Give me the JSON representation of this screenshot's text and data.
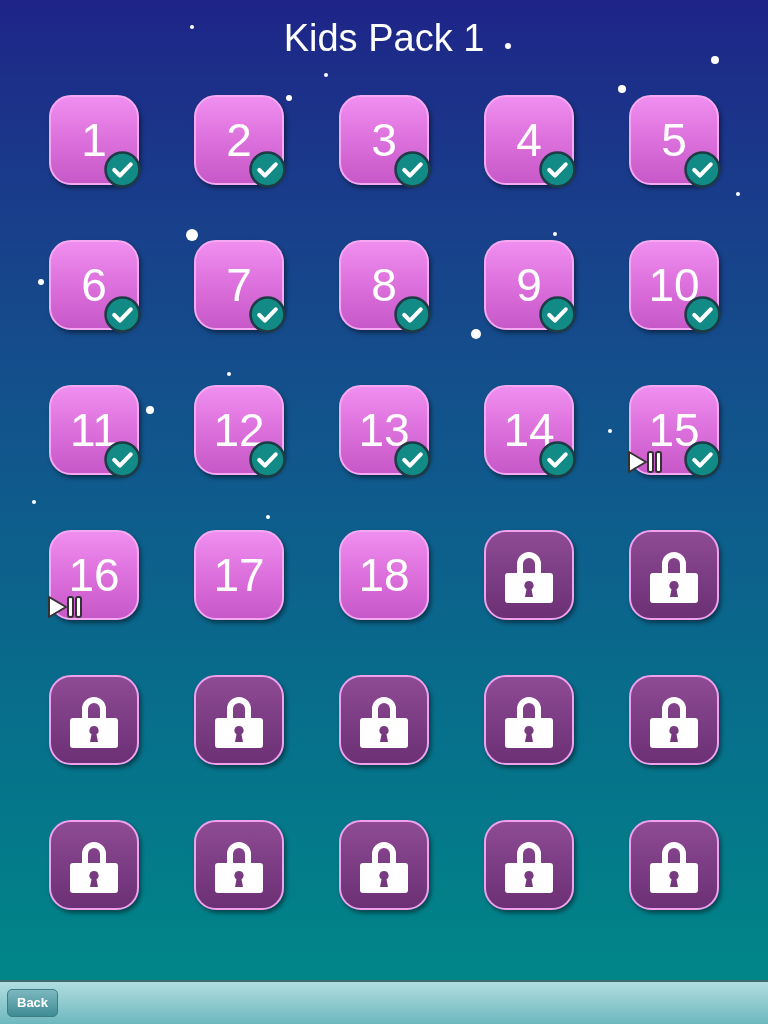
{
  "title": "Kids Pack 1",
  "levels": [
    {
      "kind": "unlocked",
      "number": "1",
      "completed": true,
      "resumable": false
    },
    {
      "kind": "unlocked",
      "number": "2",
      "completed": true,
      "resumable": false
    },
    {
      "kind": "unlocked",
      "number": "3",
      "completed": true,
      "resumable": false
    },
    {
      "kind": "unlocked",
      "number": "4",
      "completed": true,
      "resumable": false
    },
    {
      "kind": "unlocked",
      "number": "5",
      "completed": true,
      "resumable": false
    },
    {
      "kind": "unlocked",
      "number": "6",
      "completed": true,
      "resumable": false
    },
    {
      "kind": "unlocked",
      "number": "7",
      "completed": true,
      "resumable": false
    },
    {
      "kind": "unlocked",
      "number": "8",
      "completed": true,
      "resumable": false
    },
    {
      "kind": "unlocked",
      "number": "9",
      "completed": true,
      "resumable": false
    },
    {
      "kind": "unlocked",
      "number": "10",
      "completed": true,
      "resumable": false
    },
    {
      "kind": "unlocked",
      "number": "11",
      "completed": true,
      "resumable": false
    },
    {
      "kind": "unlocked",
      "number": "12",
      "completed": true,
      "resumable": false
    },
    {
      "kind": "unlocked",
      "number": "13",
      "completed": true,
      "resumable": false
    },
    {
      "kind": "unlocked",
      "number": "14",
      "completed": true,
      "resumable": false
    },
    {
      "kind": "unlocked",
      "number": "15",
      "completed": true,
      "resumable": true
    },
    {
      "kind": "unlocked",
      "number": "16",
      "completed": false,
      "resumable": true
    },
    {
      "kind": "unlocked",
      "number": "17",
      "completed": false,
      "resumable": false
    },
    {
      "kind": "unlocked",
      "number": "18",
      "completed": false,
      "resumable": false
    },
    {
      "kind": "locked"
    },
    {
      "kind": "locked"
    },
    {
      "kind": "locked"
    },
    {
      "kind": "locked"
    },
    {
      "kind": "locked"
    },
    {
      "kind": "locked"
    },
    {
      "kind": "locked"
    },
    {
      "kind": "locked"
    },
    {
      "kind": "locked"
    },
    {
      "kind": "locked"
    },
    {
      "kind": "locked"
    },
    {
      "kind": "locked"
    }
  ],
  "back_button": "Back"
}
